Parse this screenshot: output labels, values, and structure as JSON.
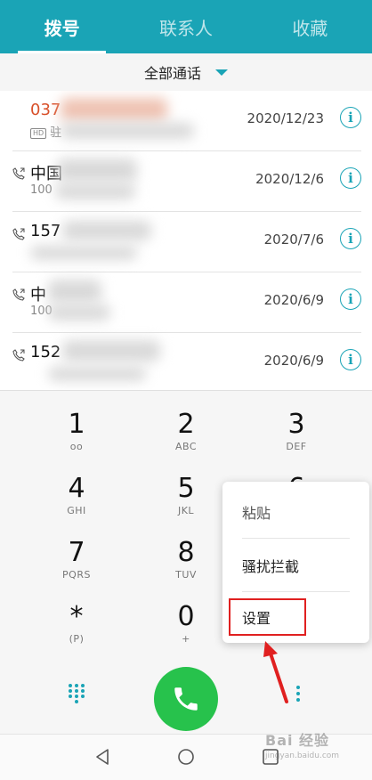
{
  "tabs": [
    {
      "label": "拨号",
      "active": true
    },
    {
      "label": "联系人",
      "active": false
    },
    {
      "label": "收藏",
      "active": false
    }
  ],
  "filter": {
    "label": "全部通话"
  },
  "calls": [
    {
      "number": "037",
      "sub": "驻",
      "hd": "HD",
      "date": "2020/12/23",
      "missed": true
    },
    {
      "number": "中国",
      "sub": "100",
      "date": "2020/12/6",
      "missed": false
    },
    {
      "number": "157",
      "sub": "",
      "date": "2020/7/6",
      "missed": false
    },
    {
      "number": "中",
      "sub": "100",
      "date": "2020/6/9",
      "missed": false
    },
    {
      "number": "152",
      "sub": "",
      "date": "2020/6/9",
      "missed": false
    }
  ],
  "keypad": [
    {
      "digit": "1",
      "letters": "ᴏᴏ"
    },
    {
      "digit": "2",
      "letters": "ABC"
    },
    {
      "digit": "3",
      "letters": "DEF"
    },
    {
      "digit": "4",
      "letters": "GHI"
    },
    {
      "digit": "5",
      "letters": "JKL"
    },
    {
      "digit": "6",
      "letters": ""
    },
    {
      "digit": "7",
      "letters": "PQRS"
    },
    {
      "digit": "8",
      "letters": "TUV"
    },
    {
      "digit": "",
      "letters": ""
    },
    {
      "digit": "*",
      "letters": "(P)"
    },
    {
      "digit": "0",
      "letters": "+"
    },
    {
      "digit": "",
      "letters": ""
    }
  ],
  "menu": {
    "paste": "粘贴",
    "block": "骚扰拦截",
    "settings": "设置"
  },
  "watermark": {
    "main": "Bai 经验",
    "sub": "jingyan.baidu.com"
  },
  "colors": {
    "accent": "#1aa4b6",
    "call": "#27c24c",
    "missed": "#d8502a",
    "annotation": "#e02020"
  },
  "icons": [
    "phone-log-icon",
    "info-icon",
    "dialpad-icon",
    "phone-icon",
    "more-vert-icon",
    "back-icon",
    "home-icon",
    "recents-icon",
    "dropdown-triangle-icon"
  ]
}
